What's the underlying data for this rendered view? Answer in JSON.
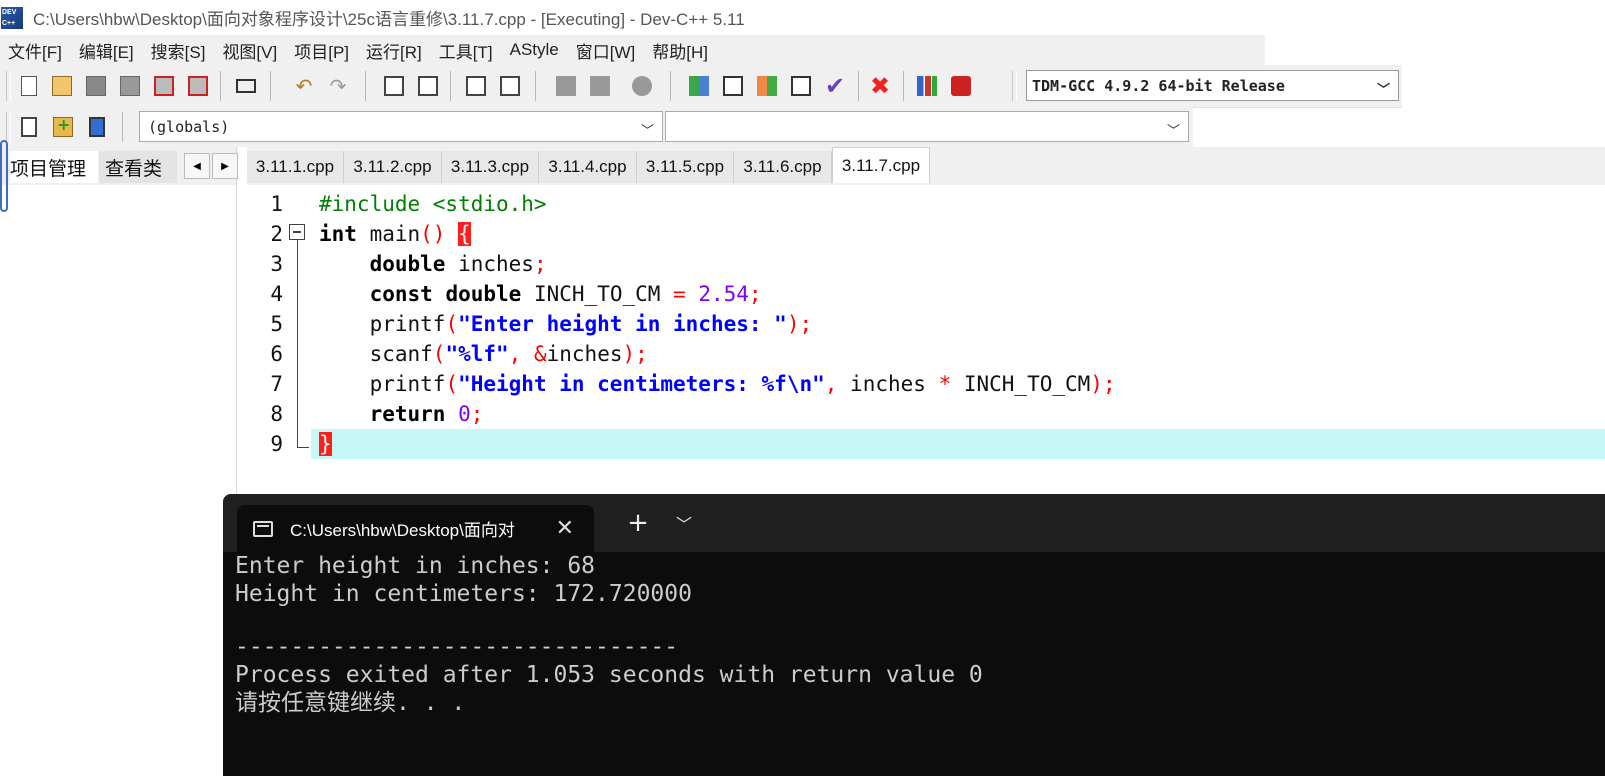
{
  "window": {
    "title": "C:\\Users\\hbw\\Desktop\\面向对象程序设计\\25c语言重修\\3.11.7.cpp - [Executing] - Dev-C++ 5.11",
    "app_icon_text": "DEV\nC++"
  },
  "menu": [
    "文件[F]",
    "编辑[E]",
    "搜索[S]",
    "视图[V]",
    "项目[P]",
    "运行[R]",
    "工具[T]",
    "AStyle",
    "窗口[W]",
    "帮助[H]"
  ],
  "toolbar": {
    "compiler": "TDM-GCC 4.9.2 64-bit Release",
    "globals": "(globals)",
    "function": ""
  },
  "left_panel": {
    "tabs": [
      "项目管理",
      "查看类"
    ]
  },
  "file_tabs": [
    "3.11.1.cpp",
    "3.11.2.cpp",
    "3.11.3.cpp",
    "3.11.4.cpp",
    "3.11.5.cpp",
    "3.11.6.cpp",
    "3.11.7.cpp"
  ],
  "active_tab": "3.11.7.cpp",
  "editor": {
    "line_numbers": [
      "1",
      "2",
      "3",
      "4",
      "5",
      "6",
      "7",
      "8",
      "9"
    ],
    "highlighted_line": 9,
    "colors": {
      "preprocessor": "#008000",
      "string": "#0000ff",
      "number": "#8000ff",
      "symbol": "#ff0000",
      "current_line": "#c8f7f7"
    },
    "lines": [
      [
        {
          "t": "#include <stdio.h>",
          "c": "pp"
        }
      ],
      [
        {
          "t": "int",
          "c": "kw"
        },
        {
          "t": " main"
        },
        {
          "t": "()",
          "c": "sym"
        },
        {
          "t": " "
        },
        {
          "t": "{",
          "c": "brace-hl"
        }
      ],
      [
        {
          "t": "    "
        },
        {
          "t": "double",
          "c": "kw"
        },
        {
          "t": " inches"
        },
        {
          "t": ";",
          "c": "sym"
        }
      ],
      [
        {
          "t": "    "
        },
        {
          "t": "const",
          "c": "kw"
        },
        {
          "t": " "
        },
        {
          "t": "double",
          "c": "kw"
        },
        {
          "t": " INCH_TO_CM "
        },
        {
          "t": "=",
          "c": "sym"
        },
        {
          "t": " "
        },
        {
          "t": "2.54",
          "c": "num"
        },
        {
          "t": ";",
          "c": "sym"
        }
      ],
      [
        {
          "t": "    printf"
        },
        {
          "t": "(",
          "c": "sym"
        },
        {
          "t": "\"Enter height in inches: \"",
          "c": "str"
        },
        {
          "t": ");",
          "c": "sym"
        }
      ],
      [
        {
          "t": "    scanf"
        },
        {
          "t": "(",
          "c": "sym"
        },
        {
          "t": "\"%lf\"",
          "c": "str"
        },
        {
          "t": ", ",
          "c": "sym"
        },
        {
          "t": "&",
          "c": "sym"
        },
        {
          "t": "inches"
        },
        {
          "t": ");",
          "c": "sym"
        }
      ],
      [
        {
          "t": "    printf"
        },
        {
          "t": "(",
          "c": "sym"
        },
        {
          "t": "\"Height in centimeters: %f\\n\"",
          "c": "str"
        },
        {
          "t": ", ",
          "c": "sym"
        },
        {
          "t": "inches "
        },
        {
          "t": "*",
          "c": "sym"
        },
        {
          "t": " INCH_TO_CM"
        },
        {
          "t": ");",
          "c": "sym"
        }
      ],
      [
        {
          "t": "    "
        },
        {
          "t": "return",
          "c": "kw"
        },
        {
          "t": " "
        },
        {
          "t": "0",
          "c": "num"
        },
        {
          "t": ";",
          "c": "sym"
        }
      ],
      [
        {
          "t": "}",
          "c": "brace-hl"
        }
      ]
    ]
  },
  "terminal": {
    "tab_title": "C:\\Users\\hbw\\Desktop\\面向对",
    "lines": [
      "Enter height in inches: 68",
      "Height in centimeters: 172.720000",
      "",
      "--------------------------------",
      "Process exited after 1.053 seconds with return value 0",
      "请按任意键继续. . ."
    ]
  }
}
